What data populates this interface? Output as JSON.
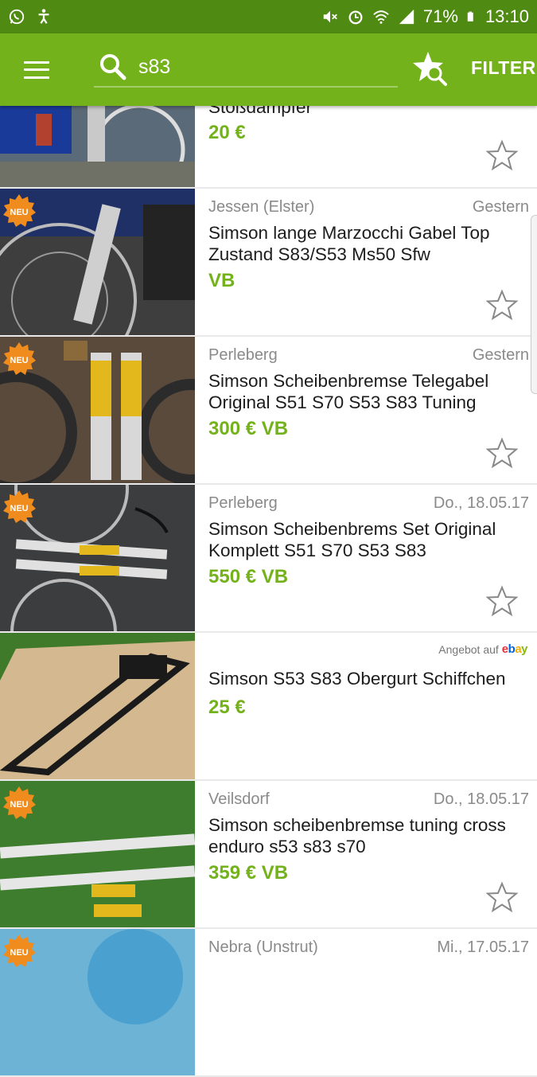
{
  "status_bar": {
    "battery": "71%",
    "time": "13:10",
    "icons": [
      "whatsapp-icon",
      "accessibility-icon",
      "mute-icon",
      "alarm-icon",
      "wifi-icon",
      "signal-icon",
      "battery-icon"
    ]
  },
  "toolbar": {
    "search_value": "s83",
    "filter_label": "FILTER"
  },
  "listings": [
    {
      "location": "",
      "date": "",
      "title": "Stoßdämpfer",
      "price": "20 €",
      "new": false,
      "ebay": false
    },
    {
      "location": "Jessen (Elster)",
      "date": "Gestern",
      "title": "Simson lange Marzocchi Gabel Top Zustand S83/S53 Ms50 Sfw",
      "price": "VB",
      "new": true,
      "ebay": false
    },
    {
      "location": "Perleberg",
      "date": "Gestern",
      "title": "Simson Scheibenbremse Telegabel Original S51 S70 S53 S83 Tuning",
      "price": "300 € VB",
      "new": true,
      "ebay": false
    },
    {
      "location": "Perleberg",
      "date": "Do., 18.05.17",
      "title": "Simson Scheibenbrems Set Original Komplett S51 S70 S53 S83",
      "price": "550 € VB",
      "new": true,
      "ebay": false
    },
    {
      "location": "",
      "date": "",
      "title": "Simson S53 S83 Obergurt Schiffchen",
      "price": "25 €",
      "new": false,
      "ebay": true
    },
    {
      "location": "Veilsdorf",
      "date": "Do., 18.05.17",
      "title": "Simson scheibenbremse tuning cross enduro s53 s83 s70",
      "price": "359 € VB",
      "new": true,
      "ebay": false
    },
    {
      "location": "Nebra (Unstrut)",
      "date": "Mi., 17.05.17",
      "title": "",
      "price": "",
      "new": true,
      "ebay": false
    }
  ],
  "badge_label": "NEU",
  "ebay_label": "Angebot auf",
  "ebay_logo": "ebay",
  "colors": {
    "accent": "#74b21b",
    "status_bar": "#4f8a12",
    "badge": "#f08c1e"
  }
}
